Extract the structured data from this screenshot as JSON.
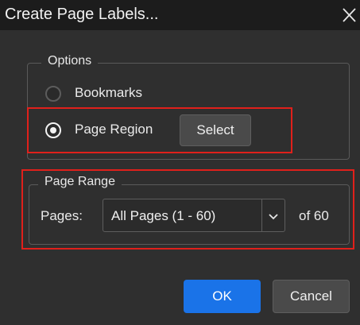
{
  "window": {
    "title": "Create Page Labels..."
  },
  "options": {
    "legend": "Options",
    "bookmarks_label": "Bookmarks",
    "page_region_label": "Page Region",
    "select_label": "Select",
    "selected": "page_region"
  },
  "page_range": {
    "legend": "Page Range",
    "pages_label": "Pages:",
    "selected_value": "All Pages (1 - 60)",
    "of_total": "of 60"
  },
  "footer": {
    "ok_label": "OK",
    "cancel_label": "Cancel"
  },
  "icons": {
    "close": "close-icon",
    "dropdown": "chevron-down-icon"
  },
  "colors": {
    "dialog_background": "#2f2f2f",
    "titlebar_background": "#1c1c1c",
    "primary_button": "#1a73e8",
    "annotation_red": "#e0201b"
  }
}
